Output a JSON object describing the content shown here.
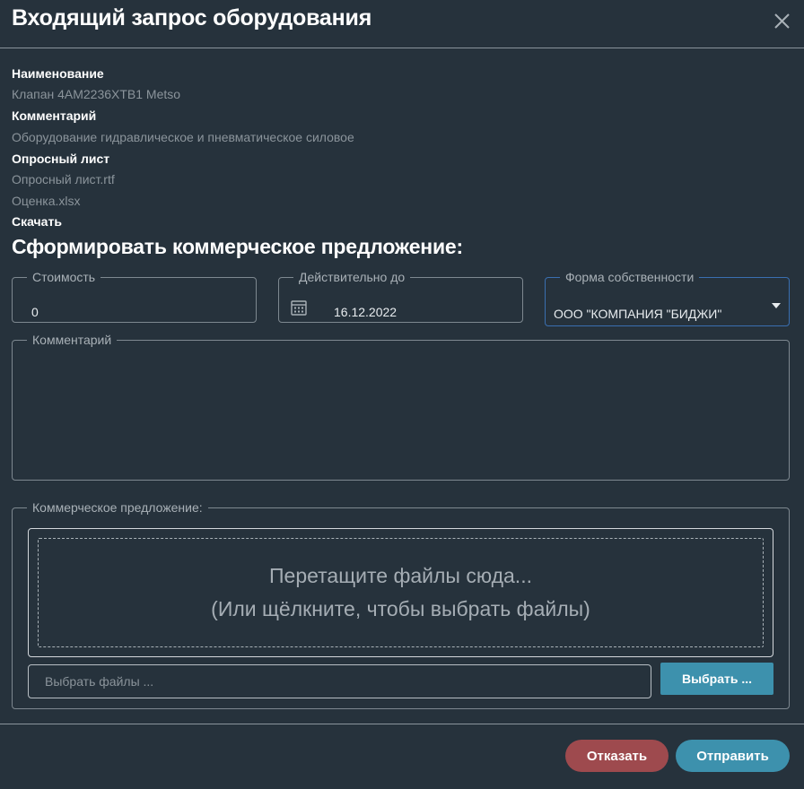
{
  "dialog": {
    "title": "Входящий запрос оборудования"
  },
  "info": {
    "name_label": "Наименование",
    "name_value": "Клапан 4AM2236XTB1 Metso",
    "comment_label": "Комментарий",
    "comment_value": "Оборудование гидравлическое и пневматическое силовое",
    "questionnaire_label": "Опросный лист",
    "files": [
      "Опросный лист.rtf",
      "Оценка.xlsx"
    ],
    "download_label": "Скачать"
  },
  "offer": {
    "heading": "Сформировать коммерческое предложение:",
    "cost_label": "Стоимость",
    "cost_value": "0",
    "valid_until_label": "Действительно до",
    "valid_until_value": "16.12.2022",
    "ownership_label": "Форма собственности",
    "ownership_value": "ООО \"КОМПАНИЯ \"БИДЖИ\"",
    "comment_label": "Комментарий",
    "comment_value": ""
  },
  "upload": {
    "legend": "Коммерческое предложение:",
    "drop_line1": "Перетащите файлы сюда...",
    "drop_line2": "(Или щёлкните, чтобы выбрать файлы)",
    "file_placeholder": "Выбрать файлы ...",
    "choose_label": "Выбрать ..."
  },
  "footer": {
    "reject_label": "Отказать",
    "send_label": "Отправить"
  },
  "colors": {
    "background": "#26323c",
    "reject": "#9e4a4e",
    "send": "#3d91ad",
    "select_focus_border": "#3a6fb0"
  },
  "icons": [
    "close-icon",
    "calendar-icon",
    "dropdown-caret-icon"
  ]
}
